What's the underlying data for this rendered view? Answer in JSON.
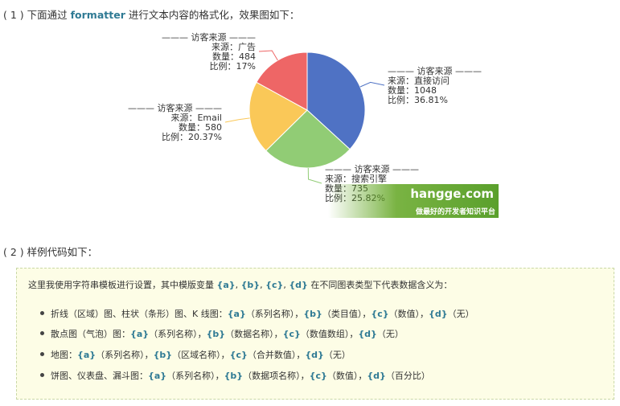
{
  "heading1": {
    "prefix": "( 1 ) 下面通过 ",
    "keyword": "formatter",
    "suffix": " 进行文本内容的格式化，效果图如下："
  },
  "chart_data": {
    "type": "pie",
    "series_title": "访客来源",
    "labels_prefix": {
      "source": "来源：",
      "count": "数量：",
      "ratio": "比例："
    },
    "slices": [
      {
        "source": "直接访问",
        "value": 1048,
        "percent": "36.81%",
        "color": "#4f72c4"
      },
      {
        "source": "搜索引擎",
        "value": 735,
        "percent": "25.82%",
        "color": "#91cc75"
      },
      {
        "source": "Email",
        "value": 580,
        "percent": "20.37%",
        "color": "#fac858"
      },
      {
        "source": "广告",
        "value": 484,
        "percent": "17%",
        "color": "#ee6666"
      }
    ]
  },
  "watermark": {
    "title": "hangge.com",
    "subtitle": "做最好的开发者知识平台"
  },
  "heading2": {
    "text": "( 2 ) 样例代码如下："
  },
  "note": {
    "intro": [
      {
        "t": "这里我使用字符串模板进行设置，其中模版变量 ",
        "kw": false
      },
      {
        "t": "{a}",
        "kw": true
      },
      {
        "t": ", ",
        "kw": false
      },
      {
        "t": "{b}",
        "kw": true
      },
      {
        "t": ", ",
        "kw": false
      },
      {
        "t": "{c}",
        "kw": true
      },
      {
        "t": ", ",
        "kw": false
      },
      {
        "t": "{d}",
        "kw": true
      },
      {
        "t": " 在不同图表类型下代表数据含义为：",
        "kw": false
      }
    ],
    "items": [
      [
        {
          "t": "折线（区域）图、柱状（条形）图、K 线图：",
          "kw": false
        },
        {
          "t": "{a}",
          "kw": true
        },
        {
          "t": "（系列名称），",
          "kw": false
        },
        {
          "t": "{b}",
          "kw": true
        },
        {
          "t": "（类目值），",
          "kw": false
        },
        {
          "t": "{c}",
          "kw": true
        },
        {
          "t": "（数值），",
          "kw": false
        },
        {
          "t": "{d}",
          "kw": true
        },
        {
          "t": "（无）",
          "kw": false
        }
      ],
      [
        {
          "t": "散点图（气泡）图：",
          "kw": false
        },
        {
          "t": "{a}",
          "kw": true
        },
        {
          "t": "（系列名称），",
          "kw": false
        },
        {
          "t": "{b}",
          "kw": true
        },
        {
          "t": "（数据名称），",
          "kw": false
        },
        {
          "t": "{c}",
          "kw": true
        },
        {
          "t": "（数值数组），",
          "kw": false
        },
        {
          "t": "{d}",
          "kw": true
        },
        {
          "t": "（无）",
          "kw": false
        }
      ],
      [
        {
          "t": "地图：",
          "kw": false
        },
        {
          "t": "{a}",
          "kw": true
        },
        {
          "t": "（系列名称），",
          "kw": false
        },
        {
          "t": "{b}",
          "kw": true
        },
        {
          "t": "（区域名称），",
          "kw": false
        },
        {
          "t": "{c}",
          "kw": true
        },
        {
          "t": "（合并数值），",
          "kw": false
        },
        {
          "t": "{d}",
          "kw": true
        },
        {
          "t": "（无）",
          "kw": false
        }
      ],
      [
        {
          "t": "饼图、仪表盘、漏斗图：",
          "kw": false
        },
        {
          "t": "{a}",
          "kw": true
        },
        {
          "t": "（系列名称），",
          "kw": false
        },
        {
          "t": "{b}",
          "kw": true
        },
        {
          "t": "（数据项名称），",
          "kw": false
        },
        {
          "t": "{c}",
          "kw": true
        },
        {
          "t": "（数值），",
          "kw": false
        },
        {
          "t": "{d}",
          "kw": true
        },
        {
          "t": "（百分比）",
          "kw": false
        }
      ]
    ]
  }
}
